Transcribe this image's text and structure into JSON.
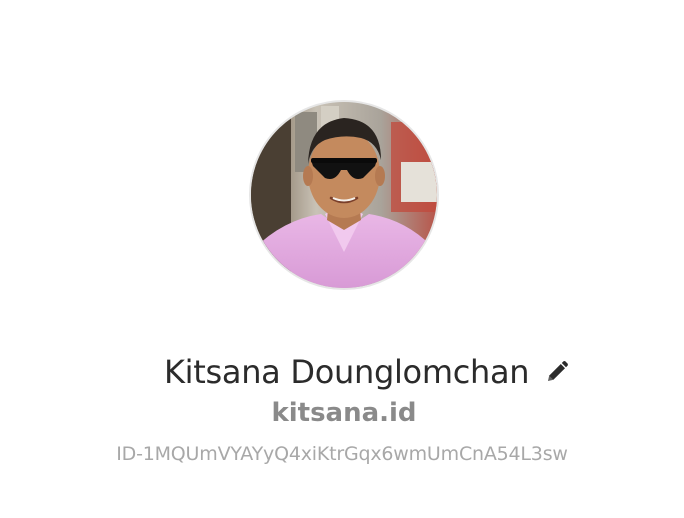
{
  "profile": {
    "display_name": "Kitsana Dounglomchan",
    "username": "kitsana.id",
    "user_id": "ID-1MQUmVYAYyQ4xiKtrGqx6wmUmCnA54L3sw",
    "avatar_icon": "profile-photo",
    "edit_icon": "pencil-icon"
  },
  "colors": {
    "name_text": "#2b2b2b",
    "username_text": "#8a8a8a",
    "id_text": "#a8a8a8",
    "background": "#ffffff"
  }
}
